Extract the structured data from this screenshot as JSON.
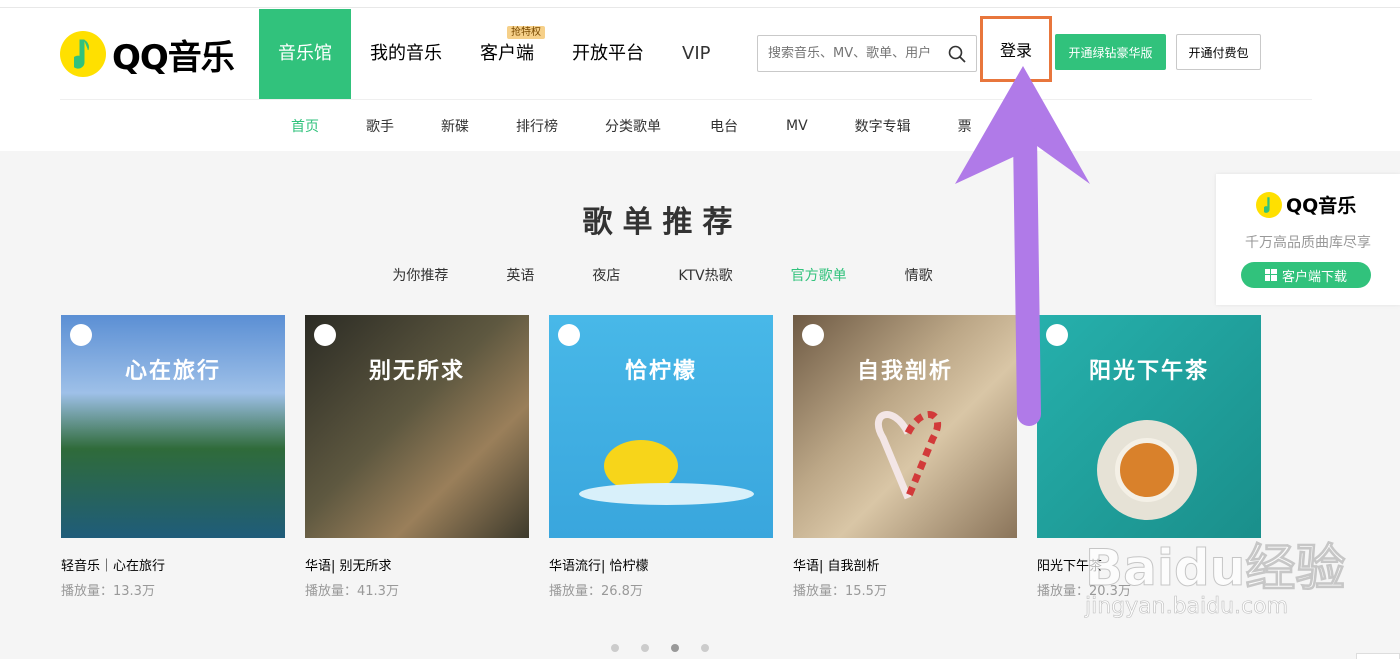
{
  "brand": {
    "name": "QQ音乐"
  },
  "nav": {
    "items": [
      {
        "label": "音乐馆",
        "active": true
      },
      {
        "label": "我的音乐"
      },
      {
        "label": "客户端",
        "badge": "抢特权"
      },
      {
        "label": "开放平台"
      },
      {
        "label": "VIP"
      }
    ]
  },
  "search": {
    "placeholder": "搜索音乐、MV、歌单、用户"
  },
  "account": {
    "login_label": "登录",
    "green_button": "开通绿钻豪华版",
    "paid_button": "开通付费包"
  },
  "subnav": {
    "items": [
      "首页",
      "歌手",
      "新碟",
      "排行榜",
      "分类歌单",
      "电台",
      "MV",
      "数字专辑",
      "票"
    ]
  },
  "playlist_section": {
    "title": "歌单推荐",
    "tags": [
      {
        "label": "为你推荐"
      },
      {
        "label": "英语"
      },
      {
        "label": "夜店"
      },
      {
        "label": "KTV热歌"
      },
      {
        "label": "官方歌单",
        "active": true
      },
      {
        "label": "情歌"
      }
    ],
    "cards": [
      {
        "cover_title": "心在旅行",
        "name": "轻音乐｜心在旅行",
        "plays": "播放量：13.3万",
        "colors": [
          "#4a7fc4",
          "#2f6b3a"
        ]
      },
      {
        "cover_title": "别无所求",
        "name": "华语| 别无所求",
        "plays": "播放量：41.3万",
        "colors": [
          "#3b3a30",
          "#7a5e3e"
        ]
      },
      {
        "cover_title": "恰柠檬",
        "name": "华语流行| 恰柠檬",
        "plays": "播放量：26.8万",
        "colors": [
          "#4cb6e6",
          "#2a98d6"
        ]
      },
      {
        "cover_title": "自我剖析",
        "name": "华语| 自我剖析",
        "plays": "播放量：15.5万",
        "colors": [
          "#b79f80",
          "#7a6650"
        ]
      },
      {
        "cover_title": "阳光下午茶",
        "name": "阳光下午茶",
        "plays": "播放量：20.3万",
        "colors": [
          "#1fa3a0",
          "#187f7c"
        ]
      }
    ],
    "carousel_dots": 4,
    "carousel_active": 3
  },
  "promo": {
    "brand": "QQ音乐",
    "subtitle": "千万高品质曲库尽享",
    "button": "客户端下载"
  },
  "watermark": {
    "text": "Baidu经验",
    "url": "jingyan.baidu.com"
  },
  "colors": {
    "accent": "#31c27c",
    "highlight_box": "#e8763c",
    "arrow": "#b07ae8"
  }
}
